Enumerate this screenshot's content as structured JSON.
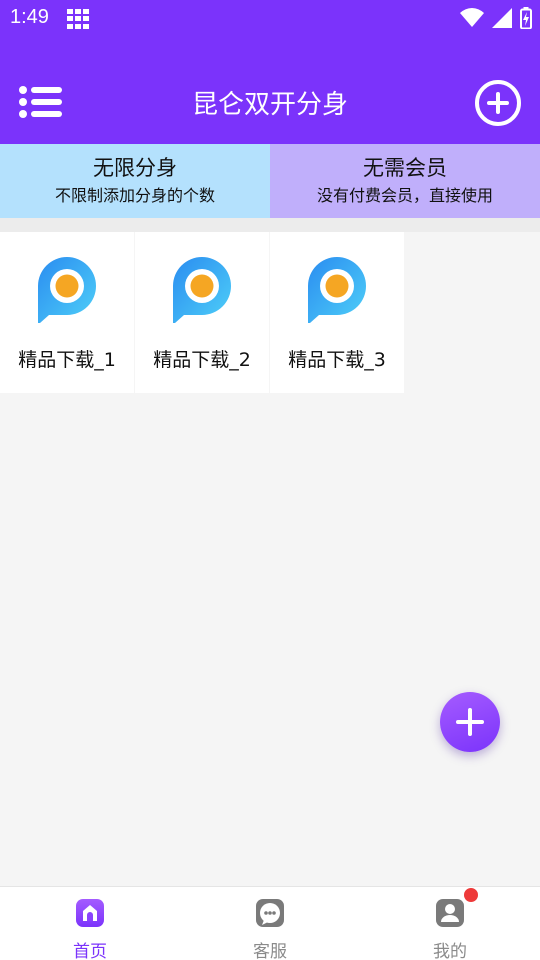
{
  "status_bar": {
    "time": "1:49",
    "icons": [
      "grid-icon",
      "wifi-icon",
      "signal-icon",
      "battery-charging-icon"
    ]
  },
  "header": {
    "title": "昆仑双开分身",
    "menu_icon": "list-menu-icon",
    "add_icon": "add-circle-icon",
    "background_color": "#7b33fb"
  },
  "banner": {
    "left": {
      "title": "无限分身",
      "subtitle": "不限制添加分身的个数",
      "color": "#b4e1fd"
    },
    "right": {
      "title": "无需会员",
      "subtitle": "没有付费会员，直接使用",
      "color": "#c0affb"
    }
  },
  "apps": [
    {
      "label": "精品下载_1",
      "icon": "p-app-icon"
    },
    {
      "label": "精品下载_2",
      "icon": "p-app-icon"
    },
    {
      "label": "精品下载_3",
      "icon": "p-app-icon"
    }
  ],
  "fab": {
    "icon": "plus-icon"
  },
  "bottom_nav": {
    "items": [
      {
        "label": "首页",
        "icon": "home-icon",
        "active": true
      },
      {
        "label": "客服",
        "icon": "chat-icon",
        "active": false
      },
      {
        "label": "我的",
        "icon": "profile-icon",
        "active": false,
        "badge": true
      }
    ],
    "active_color": "#7b33fb"
  }
}
